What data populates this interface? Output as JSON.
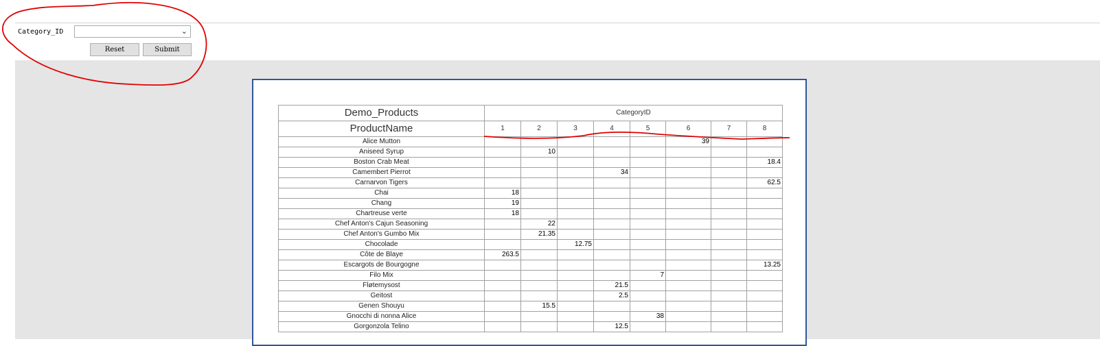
{
  "params": {
    "label": "Category_ID",
    "select_value": "",
    "chevron": "⌄",
    "reset_label": "Reset",
    "submit_label": "Submit"
  },
  "report": {
    "title": "Demo_Products",
    "row_header": "ProductName",
    "col_group_header": "CategoryID",
    "category_ids": [
      "1",
      "2",
      "3",
      "4",
      "5",
      "6",
      "7",
      "8"
    ],
    "rows": [
      {
        "name": "Alice Mutton",
        "cat": 6,
        "value": "39"
      },
      {
        "name": "Aniseed Syrup",
        "cat": 2,
        "value": "10"
      },
      {
        "name": "Boston Crab Meat",
        "cat": 8,
        "value": "18.4"
      },
      {
        "name": "Camembert Pierrot",
        "cat": 4,
        "value": "34"
      },
      {
        "name": "Carnarvon Tigers",
        "cat": 8,
        "value": "62.5"
      },
      {
        "name": "Chai",
        "cat": 1,
        "value": "18"
      },
      {
        "name": "Chang",
        "cat": 1,
        "value": "19"
      },
      {
        "name": "Chartreuse verte",
        "cat": 1,
        "value": "18"
      },
      {
        "name": "Chef Anton's Cajun Seasoning",
        "cat": 2,
        "value": "22"
      },
      {
        "name": "Chef Anton's Gumbo Mix",
        "cat": 2,
        "value": "21.35"
      },
      {
        "name": "Chocolade",
        "cat": 3,
        "value": "12.75"
      },
      {
        "name": "Côte de Blaye",
        "cat": 1,
        "value": "263.5"
      },
      {
        "name": "Escargots de Bourgogne",
        "cat": 8,
        "value": "13.25"
      },
      {
        "name": "Filo Mix",
        "cat": 5,
        "value": "7"
      },
      {
        "name": "Fløtemysost",
        "cat": 4,
        "value": "21.5"
      },
      {
        "name": "Geitost",
        "cat": 4,
        "value": "2.5"
      },
      {
        "name": "Genen Shouyu",
        "cat": 2,
        "value": "15.5"
      },
      {
        "name": "Gnocchi di nonna Alice",
        "cat": 5,
        "value": "38"
      },
      {
        "name": "Gorgonzola Telino",
        "cat": 4,
        "value": "12.5"
      }
    ]
  },
  "colors": {
    "annotation": "#e00000",
    "page_border": "#2f5597",
    "background_gray": "#e5e5e5"
  }
}
